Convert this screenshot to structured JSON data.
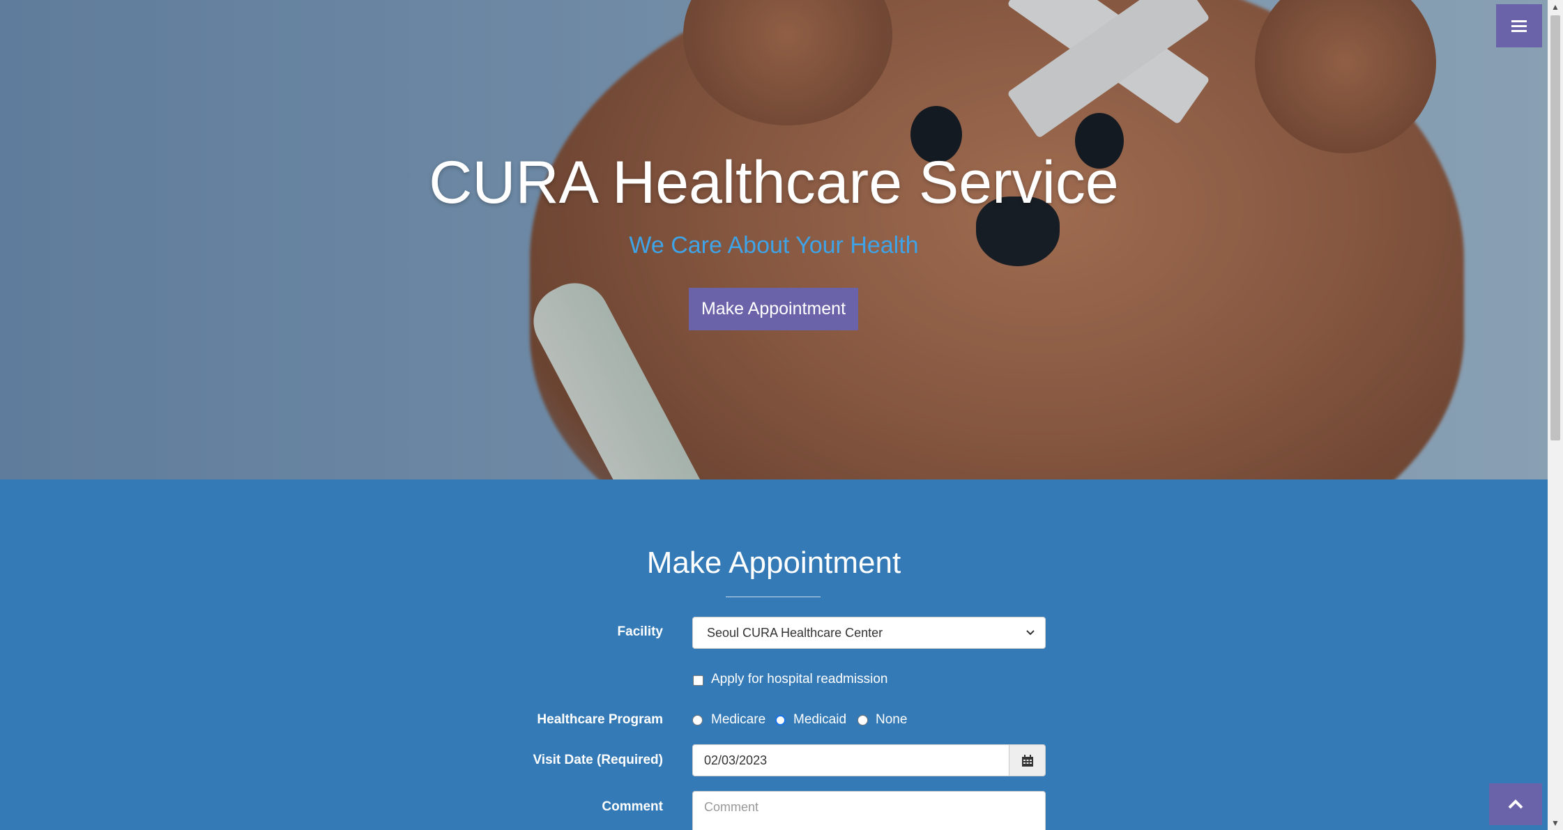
{
  "hero": {
    "title": "CURA Healthcare Service",
    "subtitle": "We Care About Your Health",
    "button_label": "Make Appointment"
  },
  "menu": {
    "icon": "hamburger-menu-icon"
  },
  "appointment": {
    "title": "Make Appointment",
    "facility": {
      "label": "Facility",
      "selected": "Seoul CURA Healthcare Center"
    },
    "readmission": {
      "label": "Apply for hospital readmission",
      "checked": false
    },
    "program": {
      "label": "Healthcare Program",
      "options": [
        "Medicare",
        "Medicaid",
        "None"
      ]
    },
    "visit_date": {
      "label": "Visit Date (Required)",
      "value": "02/03/2023",
      "icon": "calendar-icon"
    },
    "comment": {
      "label": "Comment",
      "placeholder": "Comment"
    }
  },
  "back_to_top": {
    "icon": "chevron-up-icon"
  },
  "colors": {
    "brand_purple": "#6a63a9",
    "section_blue": "#337ab7",
    "subtitle_blue": "#3fa3e8"
  }
}
